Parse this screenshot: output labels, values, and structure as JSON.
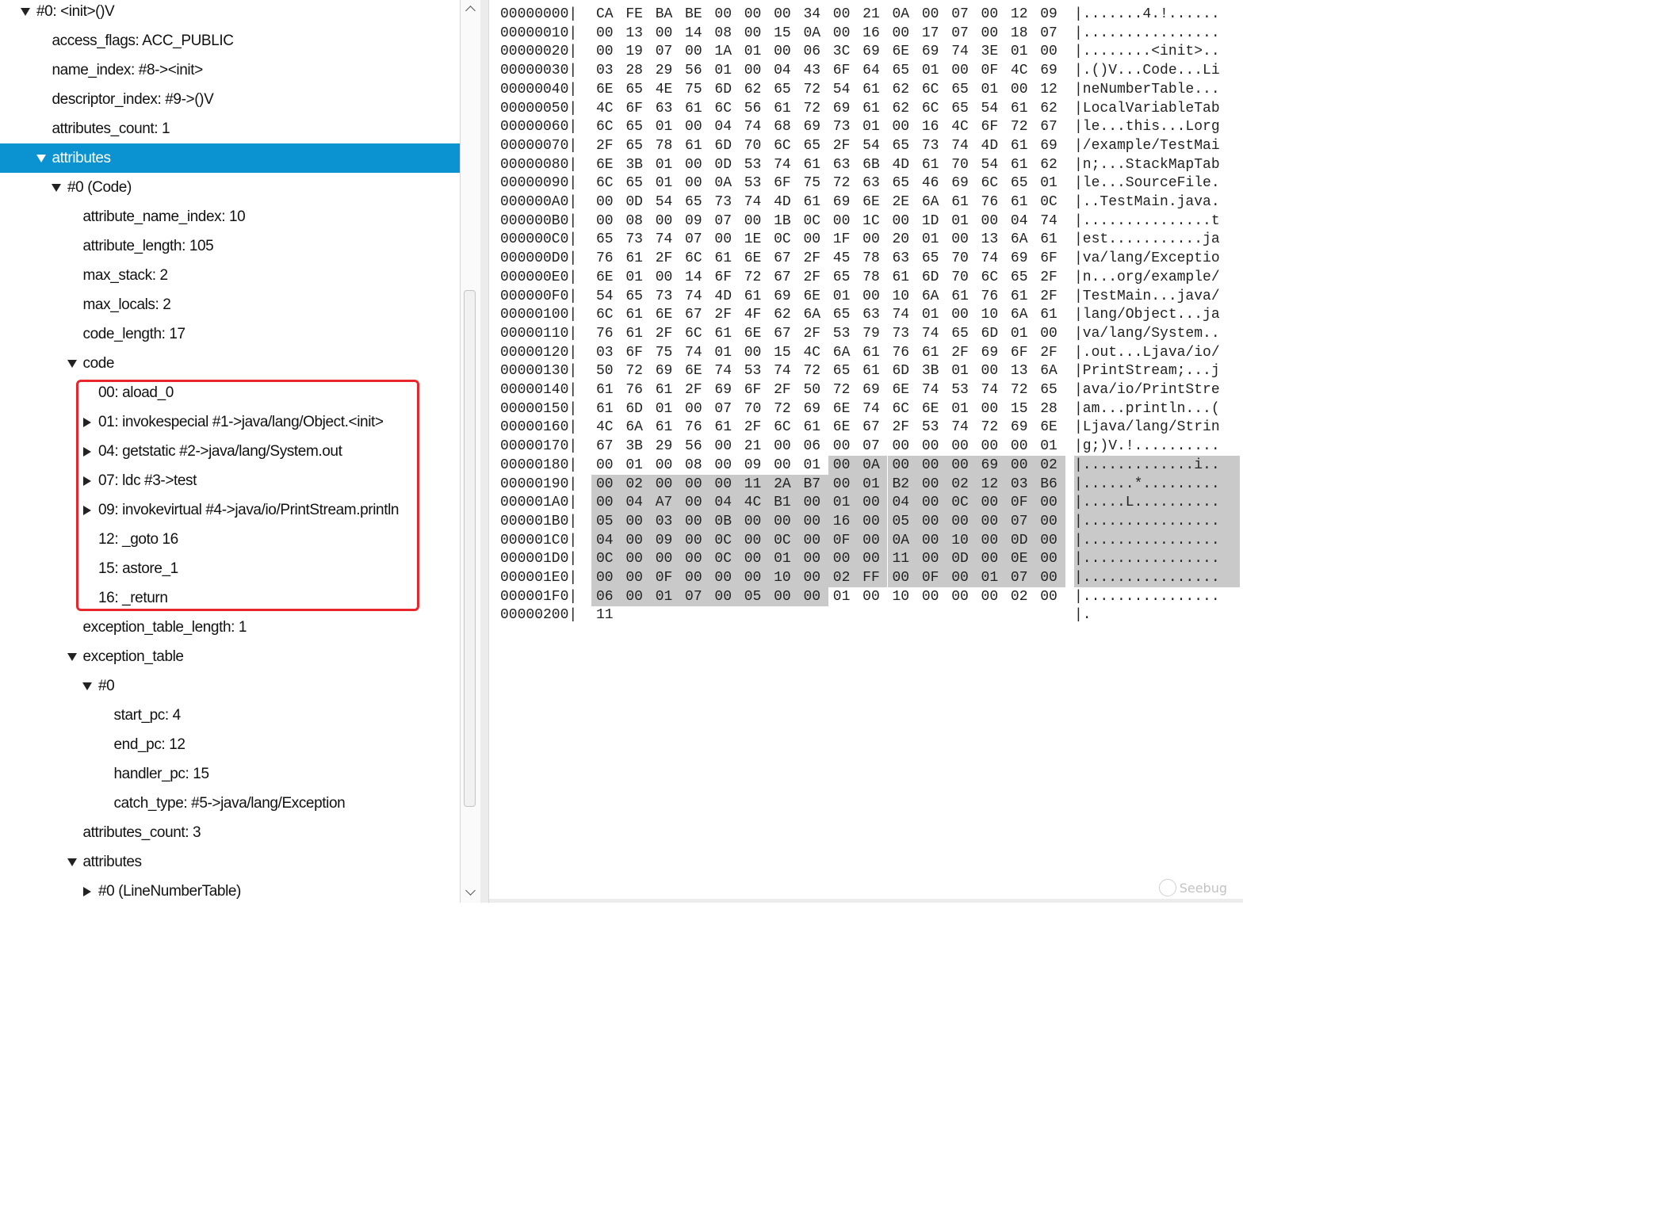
{
  "tree": [
    {
      "label": "#0: <init>()V",
      "depth": 0,
      "toggle": "down"
    },
    {
      "label": "access_flags: ACC_PUBLIC",
      "depth": 1,
      "toggle": "none"
    },
    {
      "label": "name_index: #8-><init>",
      "depth": 1,
      "toggle": "none"
    },
    {
      "label": "descriptor_index: #9->()V",
      "depth": 1,
      "toggle": "none"
    },
    {
      "label": "attributes_count: 1",
      "depth": 1,
      "toggle": "none"
    },
    {
      "label": "attributes",
      "depth": 1,
      "toggle": "down",
      "selected": true
    },
    {
      "label": "#0 (Code)",
      "depth": 2,
      "toggle": "down"
    },
    {
      "label": "attribute_name_index: 10",
      "depth": 3,
      "toggle": "none"
    },
    {
      "label": "attribute_length: 105",
      "depth": 3,
      "toggle": "none"
    },
    {
      "label": "max_stack: 2",
      "depth": 3,
      "toggle": "none"
    },
    {
      "label": "max_locals: 2",
      "depth": 3,
      "toggle": "none"
    },
    {
      "label": "code_length: 17",
      "depth": 3,
      "toggle": "none"
    },
    {
      "label": "code",
      "depth": 3,
      "toggle": "down"
    },
    {
      "label": "00: aload_0",
      "depth": 4,
      "toggle": "none"
    },
    {
      "label": "01: invokespecial #1->java/lang/Object.<init>",
      "depth": 4,
      "toggle": "right"
    },
    {
      "label": "04: getstatic #2->java/lang/System.out",
      "depth": 4,
      "toggle": "right"
    },
    {
      "label": "07: ldc #3->test",
      "depth": 4,
      "toggle": "right"
    },
    {
      "label": "09: invokevirtual #4->java/io/PrintStream.println",
      "depth": 4,
      "toggle": "right"
    },
    {
      "label": "12: _goto 16",
      "depth": 4,
      "toggle": "none"
    },
    {
      "label": "15: astore_1",
      "depth": 4,
      "toggle": "none"
    },
    {
      "label": "16: _return",
      "depth": 4,
      "toggle": "none"
    },
    {
      "label": "exception_table_length: 1",
      "depth": 3,
      "toggle": "none"
    },
    {
      "label": "exception_table",
      "depth": 3,
      "toggle": "down"
    },
    {
      "label": "#0",
      "depth": 4,
      "toggle": "down"
    },
    {
      "label": "start_pc: 4",
      "depth": 5,
      "toggle": "none"
    },
    {
      "label": "end_pc: 12",
      "depth": 5,
      "toggle": "none"
    },
    {
      "label": "handler_pc: 15",
      "depth": 5,
      "toggle": "none"
    },
    {
      "label": "catch_type: #5->java/lang/Exception",
      "depth": 5,
      "toggle": "none"
    },
    {
      "label": "attributes_count: 3",
      "depth": 3,
      "toggle": "none"
    },
    {
      "label": "attributes",
      "depth": 3,
      "toggle": "down"
    },
    {
      "label": "#0 (LineNumberTable)",
      "depth": 4,
      "toggle": "right"
    }
  ],
  "hex": {
    "rows": [
      {
        "offset": "00000000|",
        "bytes": [
          "CA",
          "FE",
          "BA",
          "BE",
          "00",
          "00",
          "00",
          "34",
          "00",
          "21",
          "0A",
          "00",
          "07",
          "00",
          "12",
          "09"
        ],
        "ascii": "|.......4.!......"
      },
      {
        "offset": "00000010|",
        "bytes": [
          "00",
          "13",
          "00",
          "14",
          "08",
          "00",
          "15",
          "0A",
          "00",
          "16",
          "00",
          "17",
          "07",
          "00",
          "18",
          "07"
        ],
        "ascii": "|................"
      },
      {
        "offset": "00000020|",
        "bytes": [
          "00",
          "19",
          "07",
          "00",
          "1A",
          "01",
          "00",
          "06",
          "3C",
          "69",
          "6E",
          "69",
          "74",
          "3E",
          "01",
          "00"
        ],
        "ascii": "|........<init>.."
      },
      {
        "offset": "00000030|",
        "bytes": [
          "03",
          "28",
          "29",
          "56",
          "01",
          "00",
          "04",
          "43",
          "6F",
          "64",
          "65",
          "01",
          "00",
          "0F",
          "4C",
          "69"
        ],
        "ascii": "|.()V...Code...Li"
      },
      {
        "offset": "00000040|",
        "bytes": [
          "6E",
          "65",
          "4E",
          "75",
          "6D",
          "62",
          "65",
          "72",
          "54",
          "61",
          "62",
          "6C",
          "65",
          "01",
          "00",
          "12"
        ],
        "ascii": "|neNumberTable..."
      },
      {
        "offset": "00000050|",
        "bytes": [
          "4C",
          "6F",
          "63",
          "61",
          "6C",
          "56",
          "61",
          "72",
          "69",
          "61",
          "62",
          "6C",
          "65",
          "54",
          "61",
          "62"
        ],
        "ascii": "|LocalVariableTab"
      },
      {
        "offset": "00000060|",
        "bytes": [
          "6C",
          "65",
          "01",
          "00",
          "04",
          "74",
          "68",
          "69",
          "73",
          "01",
          "00",
          "16",
          "4C",
          "6F",
          "72",
          "67"
        ],
        "ascii": "|le...this...Lorg"
      },
      {
        "offset": "00000070|",
        "bytes": [
          "2F",
          "65",
          "78",
          "61",
          "6D",
          "70",
          "6C",
          "65",
          "2F",
          "54",
          "65",
          "73",
          "74",
          "4D",
          "61",
          "69"
        ],
        "ascii": "|/example/TestMai"
      },
      {
        "offset": "00000080|",
        "bytes": [
          "6E",
          "3B",
          "01",
          "00",
          "0D",
          "53",
          "74",
          "61",
          "63",
          "6B",
          "4D",
          "61",
          "70",
          "54",
          "61",
          "62"
        ],
        "ascii": "|n;...StackMapTab"
      },
      {
        "offset": "00000090|",
        "bytes": [
          "6C",
          "65",
          "01",
          "00",
          "0A",
          "53",
          "6F",
          "75",
          "72",
          "63",
          "65",
          "46",
          "69",
          "6C",
          "65",
          "01"
        ],
        "ascii": "|le...SourceFile."
      },
      {
        "offset": "000000A0|",
        "bytes": [
          "00",
          "0D",
          "54",
          "65",
          "73",
          "74",
          "4D",
          "61",
          "69",
          "6E",
          "2E",
          "6A",
          "61",
          "76",
          "61",
          "0C"
        ],
        "ascii": "|..TestMain.java."
      },
      {
        "offset": "000000B0|",
        "bytes": [
          "00",
          "08",
          "00",
          "09",
          "07",
          "00",
          "1B",
          "0C",
          "00",
          "1C",
          "00",
          "1D",
          "01",
          "00",
          "04",
          "74"
        ],
        "ascii": "|...............t"
      },
      {
        "offset": "000000C0|",
        "bytes": [
          "65",
          "73",
          "74",
          "07",
          "00",
          "1E",
          "0C",
          "00",
          "1F",
          "00",
          "20",
          "01",
          "00",
          "13",
          "6A",
          "61"
        ],
        "ascii": "|est...........ja"
      },
      {
        "offset": "000000D0|",
        "bytes": [
          "76",
          "61",
          "2F",
          "6C",
          "61",
          "6E",
          "67",
          "2F",
          "45",
          "78",
          "63",
          "65",
          "70",
          "74",
          "69",
          "6F"
        ],
        "ascii": "|va/lang/Exceptio"
      },
      {
        "offset": "000000E0|",
        "bytes": [
          "6E",
          "01",
          "00",
          "14",
          "6F",
          "72",
          "67",
          "2F",
          "65",
          "78",
          "61",
          "6D",
          "70",
          "6C",
          "65",
          "2F"
        ],
        "ascii": "|n...org/example/"
      },
      {
        "offset": "000000F0|",
        "bytes": [
          "54",
          "65",
          "73",
          "74",
          "4D",
          "61",
          "69",
          "6E",
          "01",
          "00",
          "10",
          "6A",
          "61",
          "76",
          "61",
          "2F"
        ],
        "ascii": "|TestMain...java/"
      },
      {
        "offset": "00000100|",
        "bytes": [
          "6C",
          "61",
          "6E",
          "67",
          "2F",
          "4F",
          "62",
          "6A",
          "65",
          "63",
          "74",
          "01",
          "00",
          "10",
          "6A",
          "61"
        ],
        "ascii": "|lang/Object...ja"
      },
      {
        "offset": "00000110|",
        "bytes": [
          "76",
          "61",
          "2F",
          "6C",
          "61",
          "6E",
          "67",
          "2F",
          "53",
          "79",
          "73",
          "74",
          "65",
          "6D",
          "01",
          "00"
        ],
        "ascii": "|va/lang/System.."
      },
      {
        "offset": "00000120|",
        "bytes": [
          "03",
          "6F",
          "75",
          "74",
          "01",
          "00",
          "15",
          "4C",
          "6A",
          "61",
          "76",
          "61",
          "2F",
          "69",
          "6F",
          "2F"
        ],
        "ascii": "|.out...Ljava/io/"
      },
      {
        "offset": "00000130|",
        "bytes": [
          "50",
          "72",
          "69",
          "6E",
          "74",
          "53",
          "74",
          "72",
          "65",
          "61",
          "6D",
          "3B",
          "01",
          "00",
          "13",
          "6A"
        ],
        "ascii": "|PrintStream;...j"
      },
      {
        "offset": "00000140|",
        "bytes": [
          "61",
          "76",
          "61",
          "2F",
          "69",
          "6F",
          "2F",
          "50",
          "72",
          "69",
          "6E",
          "74",
          "53",
          "74",
          "72",
          "65"
        ],
        "ascii": "|ava/io/PrintStre"
      },
      {
        "offset": "00000150|",
        "bytes": [
          "61",
          "6D",
          "01",
          "00",
          "07",
          "70",
          "72",
          "69",
          "6E",
          "74",
          "6C",
          "6E",
          "01",
          "00",
          "15",
          "28"
        ],
        "ascii": "|am...println...("
      },
      {
        "offset": "00000160|",
        "bytes": [
          "4C",
          "6A",
          "61",
          "76",
          "61",
          "2F",
          "6C",
          "61",
          "6E",
          "67",
          "2F",
          "53",
          "74",
          "72",
          "69",
          "6E"
        ],
        "ascii": "|Ljava/lang/Strin"
      },
      {
        "offset": "00000170|",
        "bytes": [
          "67",
          "3B",
          "29",
          "56",
          "00",
          "21",
          "00",
          "06",
          "00",
          "07",
          "00",
          "00",
          "00",
          "00",
          "00",
          "01"
        ],
        "ascii": "|g;)V.!.........."
      },
      {
        "offset": "00000180|",
        "bytes": [
          "00",
          "01",
          "00",
          "08",
          "00",
          "09",
          "00",
          "01",
          "00",
          "0A",
          "00",
          "00",
          "00",
          "69",
          "00",
          "02"
        ],
        "ascii": "|.............i..",
        "hl_from": 8
      },
      {
        "offset": "00000190|",
        "bytes": [
          "00",
          "02",
          "00",
          "00",
          "00",
          "11",
          "2A",
          "B7",
          "00",
          "01",
          "B2",
          "00",
          "02",
          "12",
          "03",
          "B6"
        ],
        "ascii": "|......*.........",
        "hl_from": 0
      },
      {
        "offset": "000001A0|",
        "bytes": [
          "00",
          "04",
          "A7",
          "00",
          "04",
          "4C",
          "B1",
          "00",
          "01",
          "00",
          "04",
          "00",
          "0C",
          "00",
          "0F",
          "00"
        ],
        "ascii": "|.....L..........",
        "hl_from": 0
      },
      {
        "offset": "000001B0|",
        "bytes": [
          "05",
          "00",
          "03",
          "00",
          "0B",
          "00",
          "00",
          "00",
          "16",
          "00",
          "05",
          "00",
          "00",
          "00",
          "07",
          "00"
        ],
        "ascii": "|................",
        "hl_from": 0
      },
      {
        "offset": "000001C0|",
        "bytes": [
          "04",
          "00",
          "09",
          "00",
          "0C",
          "00",
          "0C",
          "00",
          "0F",
          "00",
          "0A",
          "00",
          "10",
          "00",
          "0D",
          "00"
        ],
        "ascii": "|................",
        "hl_from": 0
      },
      {
        "offset": "000001D0|",
        "bytes": [
          "0C",
          "00",
          "00",
          "00",
          "0C",
          "00",
          "01",
          "00",
          "00",
          "00",
          "11",
          "00",
          "0D",
          "00",
          "0E",
          "00"
        ],
        "ascii": "|................",
        "hl_from": 0
      },
      {
        "offset": "000001E0|",
        "bytes": [
          "00",
          "00",
          "0F",
          "00",
          "00",
          "00",
          "10",
          "00",
          "02",
          "FF",
          "00",
          "0F",
          "00",
          "01",
          "07",
          "00"
        ],
        "ascii": "|................",
        "hl_from": 0
      },
      {
        "offset": "000001F0|",
        "bytes": [
          "06",
          "00",
          "01",
          "07",
          "00",
          "05",
          "00",
          "00",
          "01",
          "00",
          "10",
          "00",
          "00",
          "00",
          "02",
          "00"
        ],
        "ascii": "|................",
        "hl_from": 0,
        "hl_to": 8
      },
      {
        "offset": "00000200|",
        "bytes": [
          "11"
        ],
        "ascii": "|."
      }
    ]
  },
  "watermark": {
    "text": "Seebug"
  },
  "colors": {
    "selection": "#0a93d0",
    "highlight_box": "#e8262b",
    "hex_highlight": "#c9c9c9"
  }
}
